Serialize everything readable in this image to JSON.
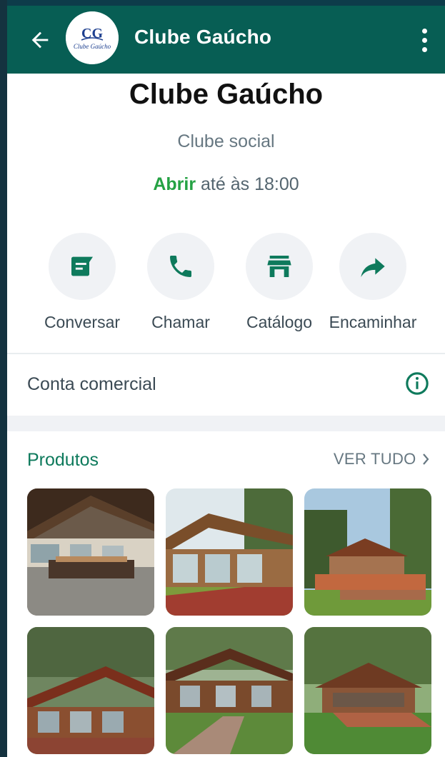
{
  "header": {
    "title": "Clube Gaúcho",
    "logo_text": "Clube Gaúcho",
    "logo_initials": "CG"
  },
  "profile": {
    "name": "Clube Gaúcho",
    "category": "Clube social",
    "hours_status": "Abrir",
    "hours_rest": " até às 18:00"
  },
  "actions": [
    {
      "label": "Conversar",
      "icon": "message-icon"
    },
    {
      "label": "Chamar",
      "icon": "phone-icon"
    },
    {
      "label": "Catálogo",
      "icon": "storefront-icon"
    },
    {
      "label": "Encaminhar",
      "icon": "forward-icon"
    }
  ],
  "business": {
    "label": "Conta comercial",
    "icon": "info-icon"
  },
  "products": {
    "title": "Produtos",
    "see_all": "VER TUDO",
    "items": [
      {
        "name": "hall-interior"
      },
      {
        "name": "glass-pavilion"
      },
      {
        "name": "wooden-deck-house"
      },
      {
        "name": "wooden-gazebo"
      },
      {
        "name": "wooden-walkway-hall"
      },
      {
        "name": "garden-kiosk"
      }
    ]
  },
  "colors": {
    "header_bg": "#075e54",
    "accent_green": "#25a244",
    "teal": "#0e7a5c"
  }
}
